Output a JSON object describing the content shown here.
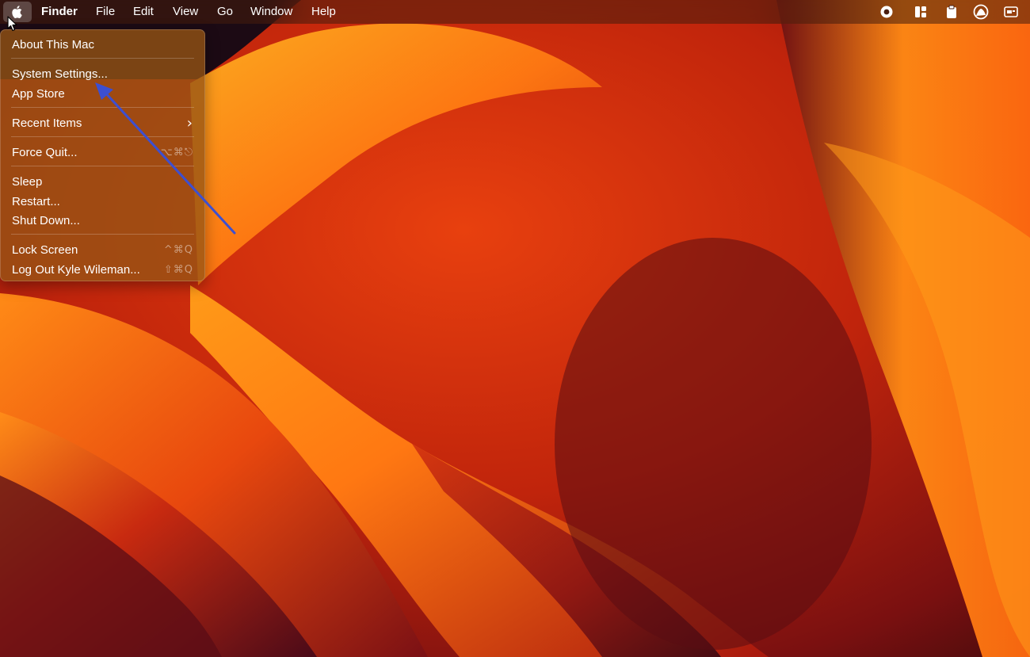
{
  "menubar": {
    "apple_icon": "apple-icon",
    "app_name": "Finder",
    "menus": [
      "File",
      "Edit",
      "View",
      "Go",
      "Window",
      "Help"
    ],
    "status_icons": [
      "screen-record-icon",
      "stage-manager-icon",
      "clipboard-icon",
      "user-account-icon",
      "control-center-icon"
    ]
  },
  "apple_menu": {
    "items": [
      {
        "label": "About This Mac",
        "shortcut": ""
      },
      {
        "label": "System Settings...",
        "shortcut": ""
      },
      {
        "label": "App Store",
        "shortcut": ""
      },
      {
        "label": "Recent Items",
        "shortcut": "›"
      },
      {
        "label": "Force Quit...",
        "shortcut": "⌥⌘⎋"
      },
      {
        "label": "Sleep",
        "shortcut": ""
      },
      {
        "label": "Restart...",
        "shortcut": ""
      },
      {
        "label": "Shut Down...",
        "shortcut": ""
      },
      {
        "label": "Lock Screen",
        "shortcut": "^⌘Q"
      },
      {
        "label": "Log Out Kyle Wileman...",
        "shortcut": "⇧⌘Q"
      }
    ]
  },
  "annotation": {
    "arrow_color": "#3d4fd0",
    "points_to": "System Settings..."
  },
  "colors": {
    "wallpaper_orange": "#ff7a10",
    "wallpaper_red": "#c8200c",
    "wallpaper_dark": "#3a0a0c"
  }
}
